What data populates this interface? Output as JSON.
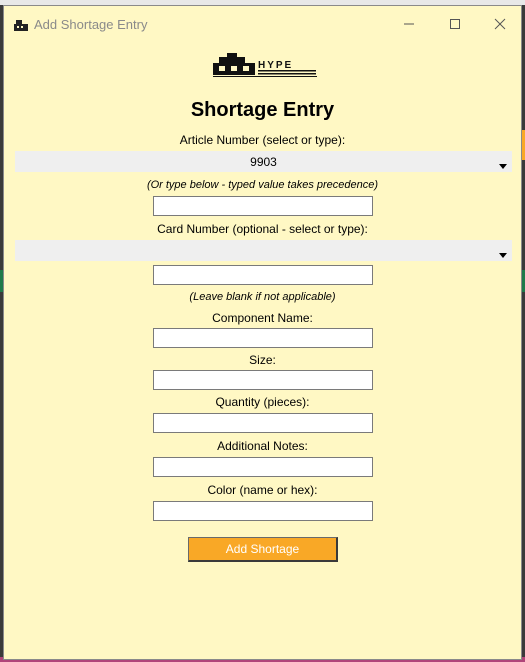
{
  "window": {
    "title": "Add Shortage Entry",
    "minimize_icon": "minimize-icon",
    "maximize_icon": "maximize-icon",
    "close_icon": "close-icon",
    "background": "#fff8c4"
  },
  "logo": {
    "text": "HYPE"
  },
  "form": {
    "heading": "Shortage Entry",
    "article_label": "Article Number (select or type):",
    "article_selected": "9903",
    "article_hint": "(Or type below - typed value takes precedence)",
    "article_input_value": "",
    "card_label": "Card Number (optional - select or type):",
    "card_selected": "",
    "card_input_value": "",
    "card_hint": "(Leave blank if not applicable)",
    "component_label": "Component Name:",
    "component_value": "",
    "size_label": "Size:",
    "size_value": "",
    "quantity_label": "Quantity (pieces):",
    "quantity_value": "",
    "notes_label": "Additional Notes:",
    "notes_value": "",
    "color_label": "Color (name or hex):",
    "color_value": "",
    "submit_label": "Add Shortage",
    "submit_color": "#f9a826"
  }
}
